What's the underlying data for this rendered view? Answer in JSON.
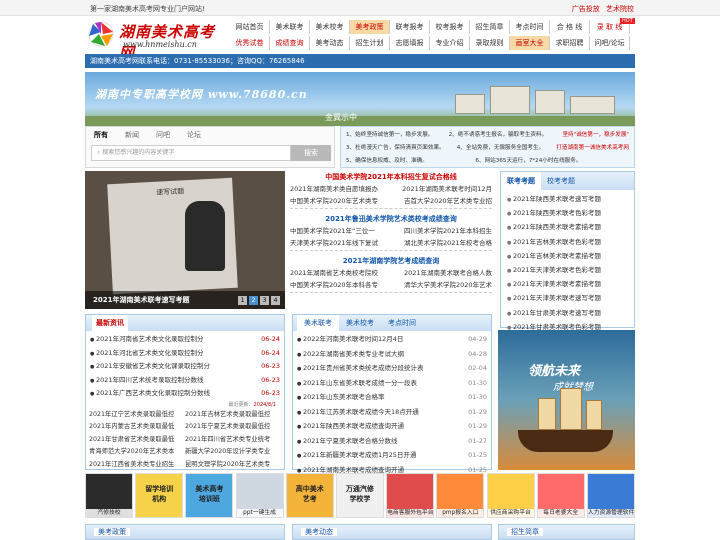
{
  "topbar": {
    "left": "第一家湖南美术高考网专业门户网站!",
    "links": [
      "广告投放",
      "艺术院校"
    ]
  },
  "logo": {
    "cn": "湖南美术高考网",
    "url": "www.hnmeishu.cn"
  },
  "nav": {
    "row1": [
      "网站首页",
      "美术联考",
      "美术校考",
      "美考政策",
      "联考报考",
      "校考报考",
      "招生简章",
      "考点时间",
      "合 格 线",
      "录 取 线"
    ],
    "row2": [
      "优秀试卷",
      "成绩查询",
      "美考动态",
      "招生计划",
      "志愿填报",
      "专业介绍",
      "录取规则",
      "画室大全",
      "求职招聘",
      "问吧/论坛"
    ],
    "hot": "HOT"
  },
  "phone": "湖南美术高考网联系电话：0731-85533036；咨询QQ：76265846",
  "banner": {
    "text": "湖南中专职高学校网 www.78680.cn",
    "badge": "金冀示中"
  },
  "search": {
    "tabs": [
      "所有",
      "新闻",
      "问吧",
      "论坛"
    ],
    "placeholder": "搜索您感兴趣的内容关键字",
    "button": "搜索"
  },
  "notice": {
    "lines": [
      {
        "a": "1、始终坚持诚信第一，稳步发展。",
        "b": "2、绝不诱惑考生报名，骗取考生资料。",
        "red": "坚持\"诚信第一，稳步发展\""
      },
      {
        "a": "3、杜绝漫天广告，保持清爽页面效果。",
        "b": "4、全站免费，无偿服务全国考生。",
        "red": "打造湖南第一诚信美术高考网"
      },
      {
        "a": "5、确保信息权威、及时、准确。",
        "b": "6、网站365天运行，7*24小时在线服务。",
        "red": ""
      }
    ]
  },
  "slide": {
    "caption": "2021年湖南美术联考速写考题",
    "pages": [
      "1",
      "2",
      "3",
      "4"
    ],
    "paper_title": "速写试题"
  },
  "middle": {
    "h1": "中国美术学院2021年本科招生复试合格线",
    "rows1": [
      [
        "2021年湖南美术类自愿填报办",
        "2021年湖南美术联考时间12月"
      ],
      [
        "中国美术学院2020年艺术类专",
        "吉首大学2020年艺术类专业招"
      ]
    ],
    "h2": "2021年鲁迅美术学院艺术类校考成绩查询",
    "rows2": [
      [
        "中国美术学院2021年“三位一",
        "四川美术学院2021年本科招生"
      ],
      [
        "天津美术学院2021年线下复试",
        "湖北美术学院2021年校考合格"
      ]
    ],
    "h3": "2021年湖南学院艺考成绩查询",
    "rows3": [
      [
        "2021年湖南省艺术类校考院校",
        "2021年湖南美术联考合格人数"
      ],
      [
        "中国美术学院2020年本科各专",
        "清华大学美术学院2020年艺术"
      ]
    ]
  },
  "right_panel": {
    "tabs": [
      "联考考题",
      "校考考题"
    ],
    "items": [
      "2021年陕西美术联考速写考题",
      "2021年陕西美术联考色彩考题",
      "2021年陕西美术联考素描考题",
      "2021年吉林美术联考色彩考题",
      "2021年吉林美术联考素描考题",
      "2021年天津美术联考色彩考题",
      "2021年天津美术联考素描考题",
      "2021年天津美术联考速写考题",
      "2021年甘肃美术联考速写考题",
      "2021年甘肃美术联考色彩考题",
      "2021年甘肃美术联考素描考题",
      "2021年河北美术联考素描考题"
    ]
  },
  "news": {
    "title": "最新资讯",
    "items": [
      {
        "t": "2021年河南省艺术类文化录取控制分",
        "d": "06-24"
      },
      {
        "t": "2021年河北省艺术类文化录取控制分",
        "d": "06-24"
      },
      {
        "t": "2021年安徽省艺术类文化课录取控制分",
        "d": "06-23"
      },
      {
        "t": "2021年四川艺术统考录取控制分数线",
        "d": "06-23"
      },
      {
        "t": "2021年广西艺术类文化录取控制分数线",
        "d": "06-23"
      }
    ],
    "more_label": "最近更新：",
    "more_date": "2024/8/1",
    "grid": [
      [
        "2021年辽宁艺术类录取最低控",
        "2021年吉林艺术类录取最低控"
      ],
      [
        "2021年内蒙古艺术类录取最低",
        "2021年宁夏艺术类录取最低控"
      ],
      [
        "2021年甘肃省艺术类录取最低",
        "2021年四川省艺术类专业统考"
      ],
      [
        "青海师范大学2020年艺术类本",
        "新疆大学2020年设计学类专业"
      ],
      [
        "2021年江西省美术类专业招生",
        "昆明文理学院2020年艺术类专"
      ]
    ]
  },
  "lk": {
    "tabs": [
      "美术联考",
      "美术校考",
      "考点时间"
    ],
    "items": [
      {
        "t": "2022年河南美术联考时间12月4日",
        "d": "04-29"
      },
      {
        "t": "2022年湖南省美术类专业考试大纲",
        "d": "04-28"
      },
      {
        "t": "2021年贵州省美术类统考成绩分段统计表",
        "d": "02-04"
      },
      {
        "t": "2021年山东省美术联考成绩一分一段表",
        "d": "01-30"
      },
      {
        "t": "2021年山东美术联考合格率",
        "d": "01-30"
      },
      {
        "t": "2021年江苏美术联考成绩今天18点开通",
        "d": "01-29"
      },
      {
        "t": "2021年陕西美术联考成绩查询开通",
        "d": "01-29"
      },
      {
        "t": "2021年宁夏美术联考合格分数线",
        "d": "01-27"
      },
      {
        "t": "2021年新疆美术联考成绩1月25日开通",
        "d": "01-25"
      },
      {
        "t": "2021年湖南美术联考成绩查询开通",
        "d": "01-25"
      }
    ]
  },
  "ship": {
    "l1": "领航未来",
    "l2": "成就梦想"
  },
  "tiles": [
    {
      "big": "",
      "lab": "汽修技校",
      "bg": "#2b2b2b"
    },
    {
      "big": "留学培训\n机构",
      "lab": "",
      "bg": "#f6d24a"
    },
    {
      "big": "美术高考\n培训班",
      "lab": "",
      "bg": "#4da8e0"
    },
    {
      "big": "",
      "lab": "ppt一键生成",
      "bg": "#cfd8e0"
    },
    {
      "big": "高中美术\n艺考",
      "lab": "",
      "bg": "#f4b43a"
    },
    {
      "big": "万通汽修\n学校学",
      "lab": "",
      "bg": "#f0f0f0"
    },
    {
      "big": "",
      "lab": "电商客服外包平台",
      "bg": "#e04b4b"
    },
    {
      "big": "",
      "lab": "pmp报名入口",
      "bg": "#ff8a3a"
    },
    {
      "big": "",
      "lab": "供应商采购平台",
      "bg": "#ffcf4a"
    },
    {
      "big": "",
      "lab": "每日老婆大全",
      "bg": "#ff6b6b"
    },
    {
      "big": "",
      "lab": "人力资源管理软件",
      "bg": "#3a7bd5"
    }
  ],
  "bottom": [
    "美考政策",
    "美考动态",
    "招生简章"
  ]
}
